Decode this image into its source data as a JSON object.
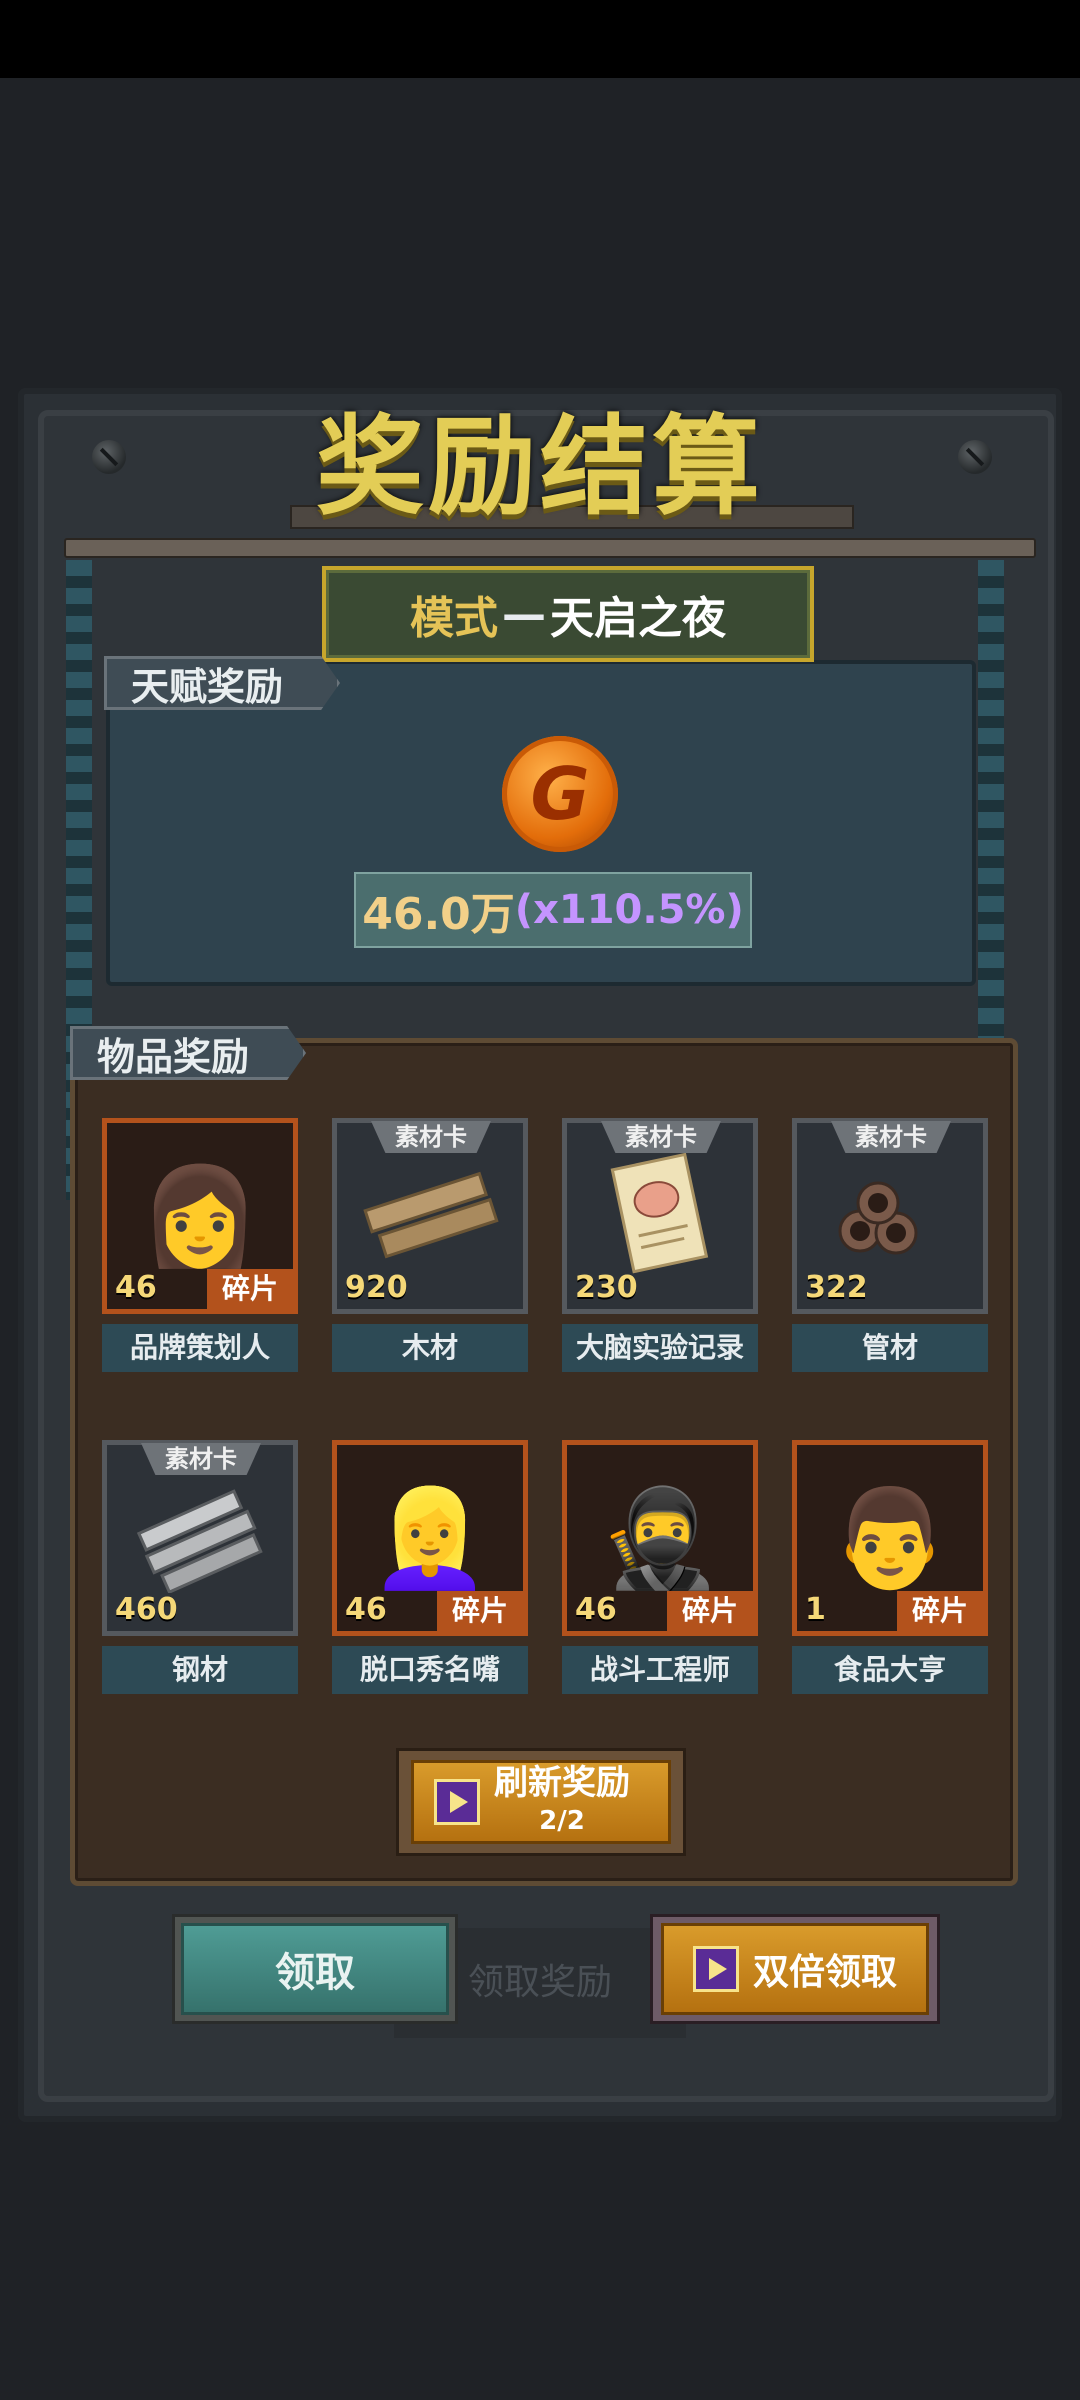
{
  "title": "奖励结算",
  "mode": {
    "prefix": "模式",
    "dash": "—",
    "name": "天启之夜"
  },
  "talent": {
    "label": "天赋奖励",
    "amount": "46.0万",
    "multiplier": "(x110.5%)",
    "coin_letter": "G"
  },
  "items_section": {
    "label": "物品奖励"
  },
  "items": [
    {
      "name": "品牌策划人",
      "count": "46",
      "type": "shard",
      "badge": "碎片",
      "icon": "portrait-woman-icon"
    },
    {
      "name": "木材",
      "count": "920",
      "type": "material",
      "badge": "素材卡",
      "icon": "wood-planks-icon"
    },
    {
      "name": "大脑实验记录",
      "count": "230",
      "type": "material",
      "badge": "素材卡",
      "icon": "brain-notes-icon"
    },
    {
      "name": "管材",
      "count": "322",
      "type": "material",
      "badge": "素材卡",
      "icon": "pipes-icon"
    },
    {
      "name": "钢材",
      "count": "460",
      "type": "material",
      "badge": "素材卡",
      "icon": "steel-plates-icon"
    },
    {
      "name": "脱口秀名嘴",
      "count": "46",
      "type": "shard",
      "badge": "碎片",
      "icon": "portrait-silver-hair-icon"
    },
    {
      "name": "战斗工程师",
      "count": "46",
      "type": "shard",
      "badge": "碎片",
      "icon": "portrait-masked-icon"
    },
    {
      "name": "食品大亨",
      "count": "1",
      "type": "shard",
      "badge": "碎片",
      "icon": "portrait-man-icon"
    }
  ],
  "refresh": {
    "label": "刷新奖励",
    "count": "2/2"
  },
  "buttons": {
    "claim": "领取",
    "double_claim": "双倍领取",
    "ghost_claim": "领取奖励"
  },
  "colors": {
    "gold": "#e3cd56",
    "purple": "#c494ff",
    "teal": "#36726c",
    "orange": "#b57110"
  }
}
